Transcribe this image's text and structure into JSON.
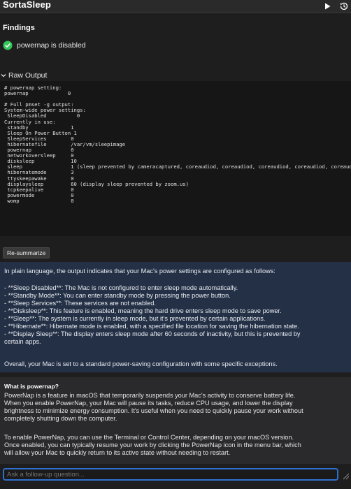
{
  "app": {
    "title": "SortaSleep"
  },
  "toolbar": {
    "play_icon": "play-icon",
    "history_icon": "history-icon"
  },
  "findings": {
    "header": "Findings",
    "items": [
      {
        "icon": "check-circle-icon",
        "text": "powernap is disabled",
        "status_color": "#34c759"
      }
    ]
  },
  "raw_output": {
    "header": "Raw Output",
    "text": "# powernap setting:\npowernap             0\n\n# Full pmset -g output:\nSystem-wide power settings:\n SleepDisabled          0\nCurrently in use:\n standby              1\n Sleep On Power Button 1\n SleepServices        0\n hibernatefile        /var/vm/sleepimage\n powernap             0\n networkoversleep     0\n disksleep            10\n sleep                1 (sleep prevented by cameracaptured, coreaudiod, coreaudiod, coreaudiod, coreaudiod, coreaudiod)\n hibernatemode        3\n ttyskeepawake        0\n displaysleep         60 (display sleep prevented by zoom.us)\n tcpkeepalive         0\n powermode            0\n womp                 0"
  },
  "resummarize_label": "Re-summarize",
  "summary": {
    "lines": [
      "In plain language, the output indicates that your Mac's power settings are configured as follows:",
      "",
      "- **Sleep Disabled**: The Mac is not configured to enter sleep mode automatically.",
      "- **Standby Mode**: You can enter standby mode by pressing the power button.",
      "- **Sleep Services**: These services are not enabled.",
      "- **Disksleep**: This feature is enabled, meaning the hard drive enters sleep mode to save power.",
      "- **Sleep**: The system is currently in sleep mode, but it's prevented by certain applications.",
      "- **Hibernate**: Hibernate mode is enabled, with a specified file location for saving the hibernation state.",
      "- **Display Sleep**: The display enters sleep mode after 60 seconds of inactivity, but this is prevented by",
      "certain apps.",
      "",
      "Overall, your Mac is set to a standard power-saving configuration with some specific exceptions."
    ]
  },
  "qa": {
    "question": "What is powernap?",
    "lines": [
      "PowerNap is a feature in macOS that temporarily suspends your Mac's activity to conserve battery life.",
      "When you enable PowerNap, your Mac will pause its tasks, reduce CPU usage, and lower the display",
      "brightness to minimize energy consumption. It's useful when you need to quickly pause your work without",
      "completely shutting down the computer.",
      "",
      "To enable PowerNap, you can use the Terminal or Control Center, depending on your macOS version.",
      "Once enabled, you can typically resume your work by clicking the PowerNap icon in the menu bar, which",
      "will allow your Mac to quickly return to its active state without needing to restart."
    ]
  },
  "followup": {
    "placeholder": "Ask a follow-up question..."
  },
  "colors": {
    "accent": "#2f6fd0",
    "summary_bg": "#243045",
    "qa_bg": "#2a2a2c"
  }
}
